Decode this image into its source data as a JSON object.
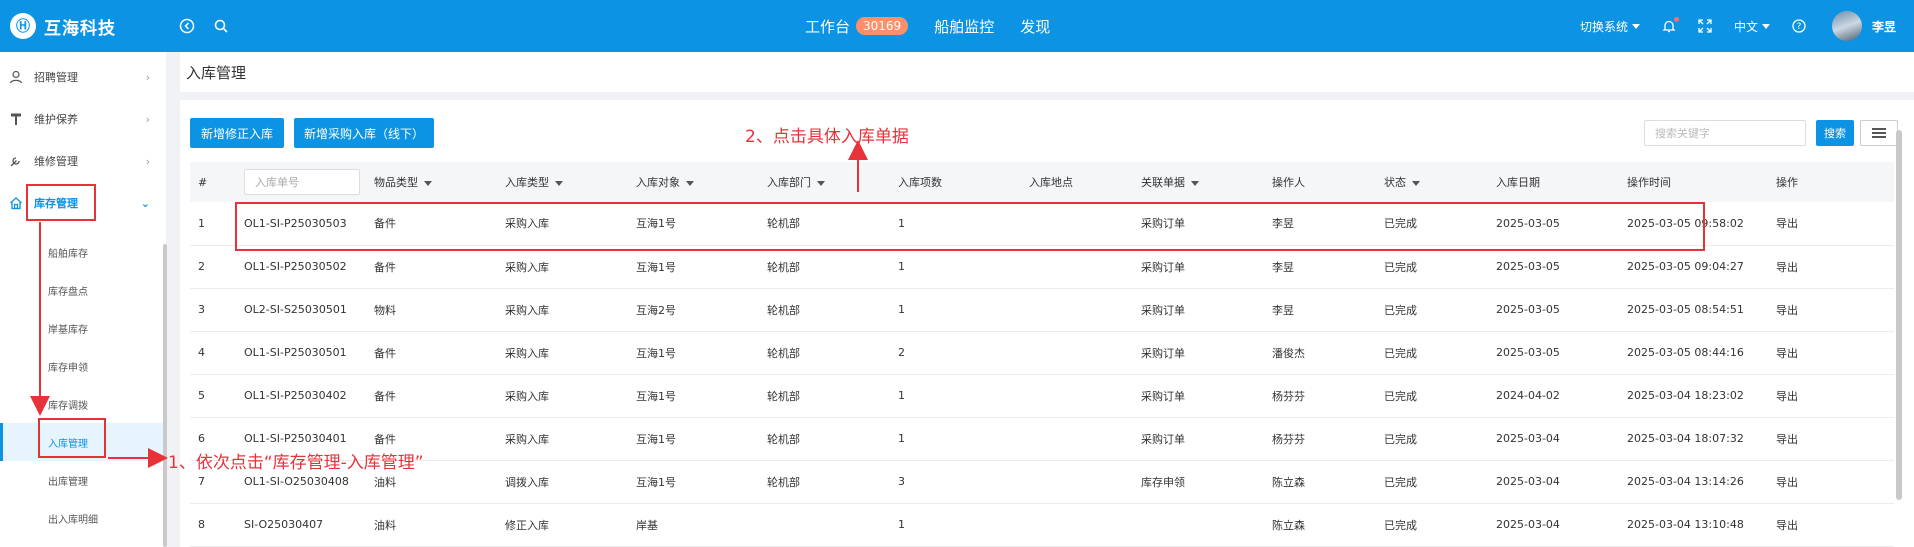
{
  "header": {
    "logo_glyph": "Ⓗ",
    "brand": "互海科技",
    "nav": [
      {
        "label": "工作台",
        "badge": "30169"
      },
      {
        "label": "船舶监控"
      },
      {
        "label": "发现"
      }
    ],
    "switch_system": "切换系统",
    "language": "中文",
    "username": "李昱"
  },
  "sidebar": {
    "items": [
      {
        "label": "招聘管理",
        "icon": "person-icon"
      },
      {
        "label": "维护保养",
        "icon": "hammer-icon"
      },
      {
        "label": "维修管理",
        "icon": "wrench-icon"
      },
      {
        "label": "库存管理",
        "icon": "home-icon"
      }
    ],
    "sub_items": [
      "船舶库存",
      "库存盘点",
      "岸基库存",
      "库存申领",
      "库存调拨",
      "入库管理",
      "出库管理",
      "出入库明细"
    ]
  },
  "page": {
    "title": "入库管理",
    "btn_new_correction": "新增修正入库",
    "btn_new_purchase": "新增采购入库（线下）",
    "search_placeholder": "搜索关键字",
    "search_btn": "搜索"
  },
  "table": {
    "headers": [
      "#",
      "入库单号",
      "物品类型",
      "入库类型",
      "入库对象",
      "入库部门",
      "入库项数",
      "入库地点",
      "关联单据",
      "操作人",
      "状态",
      "入库日期",
      "操作时间",
      "操作"
    ],
    "rows": [
      [
        "1",
        "OL1-SI-P25030503",
        "备件",
        "采购入库",
        "互海1号",
        "轮机部",
        "1",
        "",
        "采购订单",
        "李昱",
        "已完成",
        "2025-03-05",
        "2025-03-05 09:58:02",
        "导出"
      ],
      [
        "2",
        "OL1-SI-P25030502",
        "备件",
        "采购入库",
        "互海1号",
        "轮机部",
        "1",
        "",
        "采购订单",
        "李昱",
        "已完成",
        "2025-03-05",
        "2025-03-05 09:04:27",
        "导出"
      ],
      [
        "3",
        "OL2-SI-S25030501",
        "物料",
        "采购入库",
        "互海2号",
        "轮机部",
        "1",
        "",
        "采购订单",
        "李昱",
        "已完成",
        "2025-03-05",
        "2025-03-05 08:54:51",
        "导出"
      ],
      [
        "4",
        "OL1-SI-P25030501",
        "备件",
        "采购入库",
        "互海1号",
        "轮机部",
        "2",
        "",
        "采购订单",
        "潘俊杰",
        "已完成",
        "2025-03-05",
        "2025-03-05 08:44:16",
        "导出"
      ],
      [
        "5",
        "OL1-SI-P25030402",
        "备件",
        "采购入库",
        "互海1号",
        "轮机部",
        "1",
        "",
        "采购订单",
        "杨芬芬",
        "已完成",
        "2024-04-02",
        "2025-03-04 18:23:02",
        "导出"
      ],
      [
        "6",
        "OL1-SI-P25030401",
        "备件",
        "采购入库",
        "互海1号",
        "轮机部",
        "1",
        "",
        "采购订单",
        "杨芬芬",
        "已完成",
        "2025-03-04",
        "2025-03-04 18:07:32",
        "导出"
      ],
      [
        "7",
        "OL1-SI-O25030408",
        "油料",
        "调拨入库",
        "互海1号",
        "轮机部",
        "3",
        "",
        "库存申领",
        "陈立森",
        "已完成",
        "2025-03-04",
        "2025-03-04 13:14:26",
        "导出"
      ],
      [
        "8",
        "SI-O25030407",
        "油料",
        "修正入库",
        "岸基",
        "",
        "1",
        "",
        "",
        "陈立森",
        "已完成",
        "2025-03-04",
        "2025-03-04 13:10:48",
        "导出"
      ]
    ]
  },
  "annotations": {
    "step1": "1、依次点击“库存管理-入库管理”",
    "step2": "2、点击具体入库单据"
  },
  "colors": {
    "primary": "#0c93e4",
    "annotation": "#e8323a",
    "link": "#4fa7e8",
    "badge": "#ff8f6b"
  }
}
